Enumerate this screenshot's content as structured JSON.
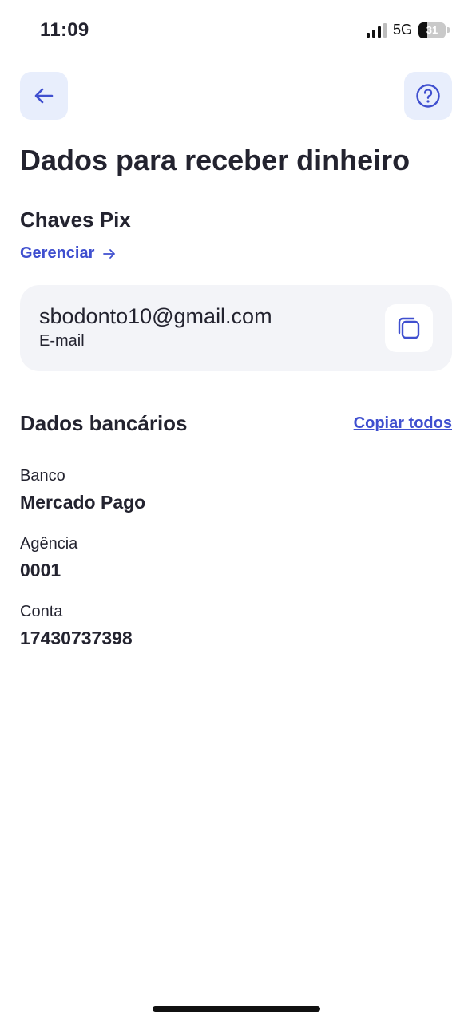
{
  "status_bar": {
    "time": "11:09",
    "network": "5G",
    "battery": "31",
    "battery_fraction": 0.31
  },
  "header": {
    "title": "Dados para receber dinheiro"
  },
  "pix": {
    "section_title": "Chaves Pix",
    "manage_label": "Gerenciar",
    "key_value": "sbodonto10@gmail.com",
    "key_type": "E-mail"
  },
  "bank": {
    "section_title": "Dados bancários",
    "copy_all_label": "Copiar todos",
    "fields": [
      {
        "label": "Banco",
        "value": "Mercado Pago"
      },
      {
        "label": "Agência",
        "value": "0001"
      },
      {
        "label": "Conta",
        "value": "17430737398"
      }
    ]
  },
  "colors": {
    "accent": "#3f4fcf",
    "icon_button_bg": "#e8eefc",
    "card_bg": "#f3f4f8",
    "text": "#23232f"
  }
}
